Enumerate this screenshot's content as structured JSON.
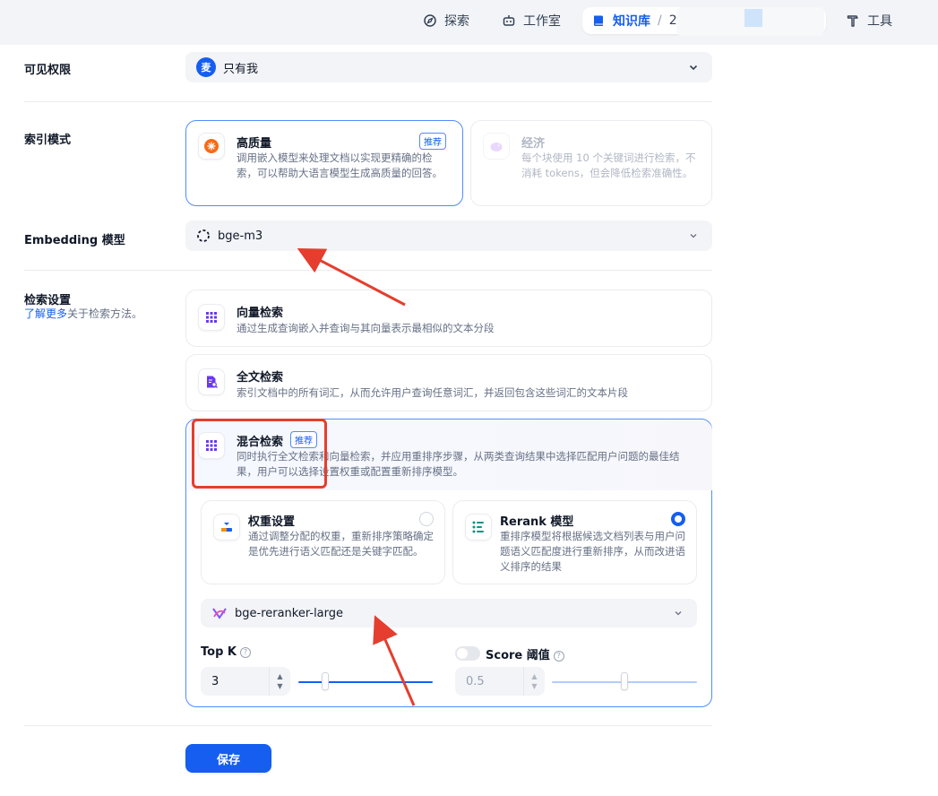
{
  "nav": {
    "explore": "探索",
    "studio": "工作室",
    "knowledge": "知识库",
    "separator": "/",
    "dataset_name": "2",
    "tools": "工具"
  },
  "permissions": {
    "label": "可见权限",
    "avatar_text": "麦",
    "value": "只有我"
  },
  "index_mode": {
    "label": "索引模式",
    "high_quality": {
      "title": "高质量",
      "badge": "推荐",
      "desc": "调用嵌入模型来处理文档以实现更精确的检索，可以帮助大语言模型生成高质量的回答。"
    },
    "economy": {
      "title": "经济",
      "desc": "每个块使用 10 个关键词进行检索，不消耗 tokens，但会降低检索准确性。"
    }
  },
  "embedding": {
    "label": "Embedding 模型",
    "value": "bge-m3"
  },
  "retrieval": {
    "label": "检索设置",
    "learn_more": "了解更多",
    "learn_more_suffix": "关于检索方法。",
    "vector": {
      "title": "向量检索",
      "desc": "通过生成查询嵌入并查询与其向量表示最相似的文本分段"
    },
    "fulltext": {
      "title": "全文检索",
      "desc": "索引文档中的所有词汇，从而允许用户查询任意词汇，并返回包含这些词汇的文本片段"
    },
    "hybrid": {
      "title": "混合检索",
      "badge": "推荐",
      "desc": "同时执行全文检索和向量检索，并应用重排序步骤，从两类查询结果中选择匹配用户问题的最佳结果，用户可以选择设置权重或配置重新排序模型。"
    },
    "weight": {
      "title": "权重设置",
      "desc": "通过调整分配的权重，重新排序策略确定是优先进行语义匹配还是关键字匹配。"
    },
    "rerank": {
      "title": "Rerank 模型",
      "desc": "重排序模型将根据候选文档列表与用户问题语义匹配度进行重新排序，从而改进语义排序的结果"
    },
    "rerank_model": "bge-reranker-large",
    "top_k": {
      "label": "Top K",
      "value": "3",
      "slider_fraction": 0.2
    },
    "score": {
      "label": "Score 阈值",
      "value": "0.5",
      "slider_fraction": 0.5
    }
  },
  "save_label": "保存",
  "colors": {
    "primary": "#155eef",
    "annotation": "#e53e2e"
  }
}
